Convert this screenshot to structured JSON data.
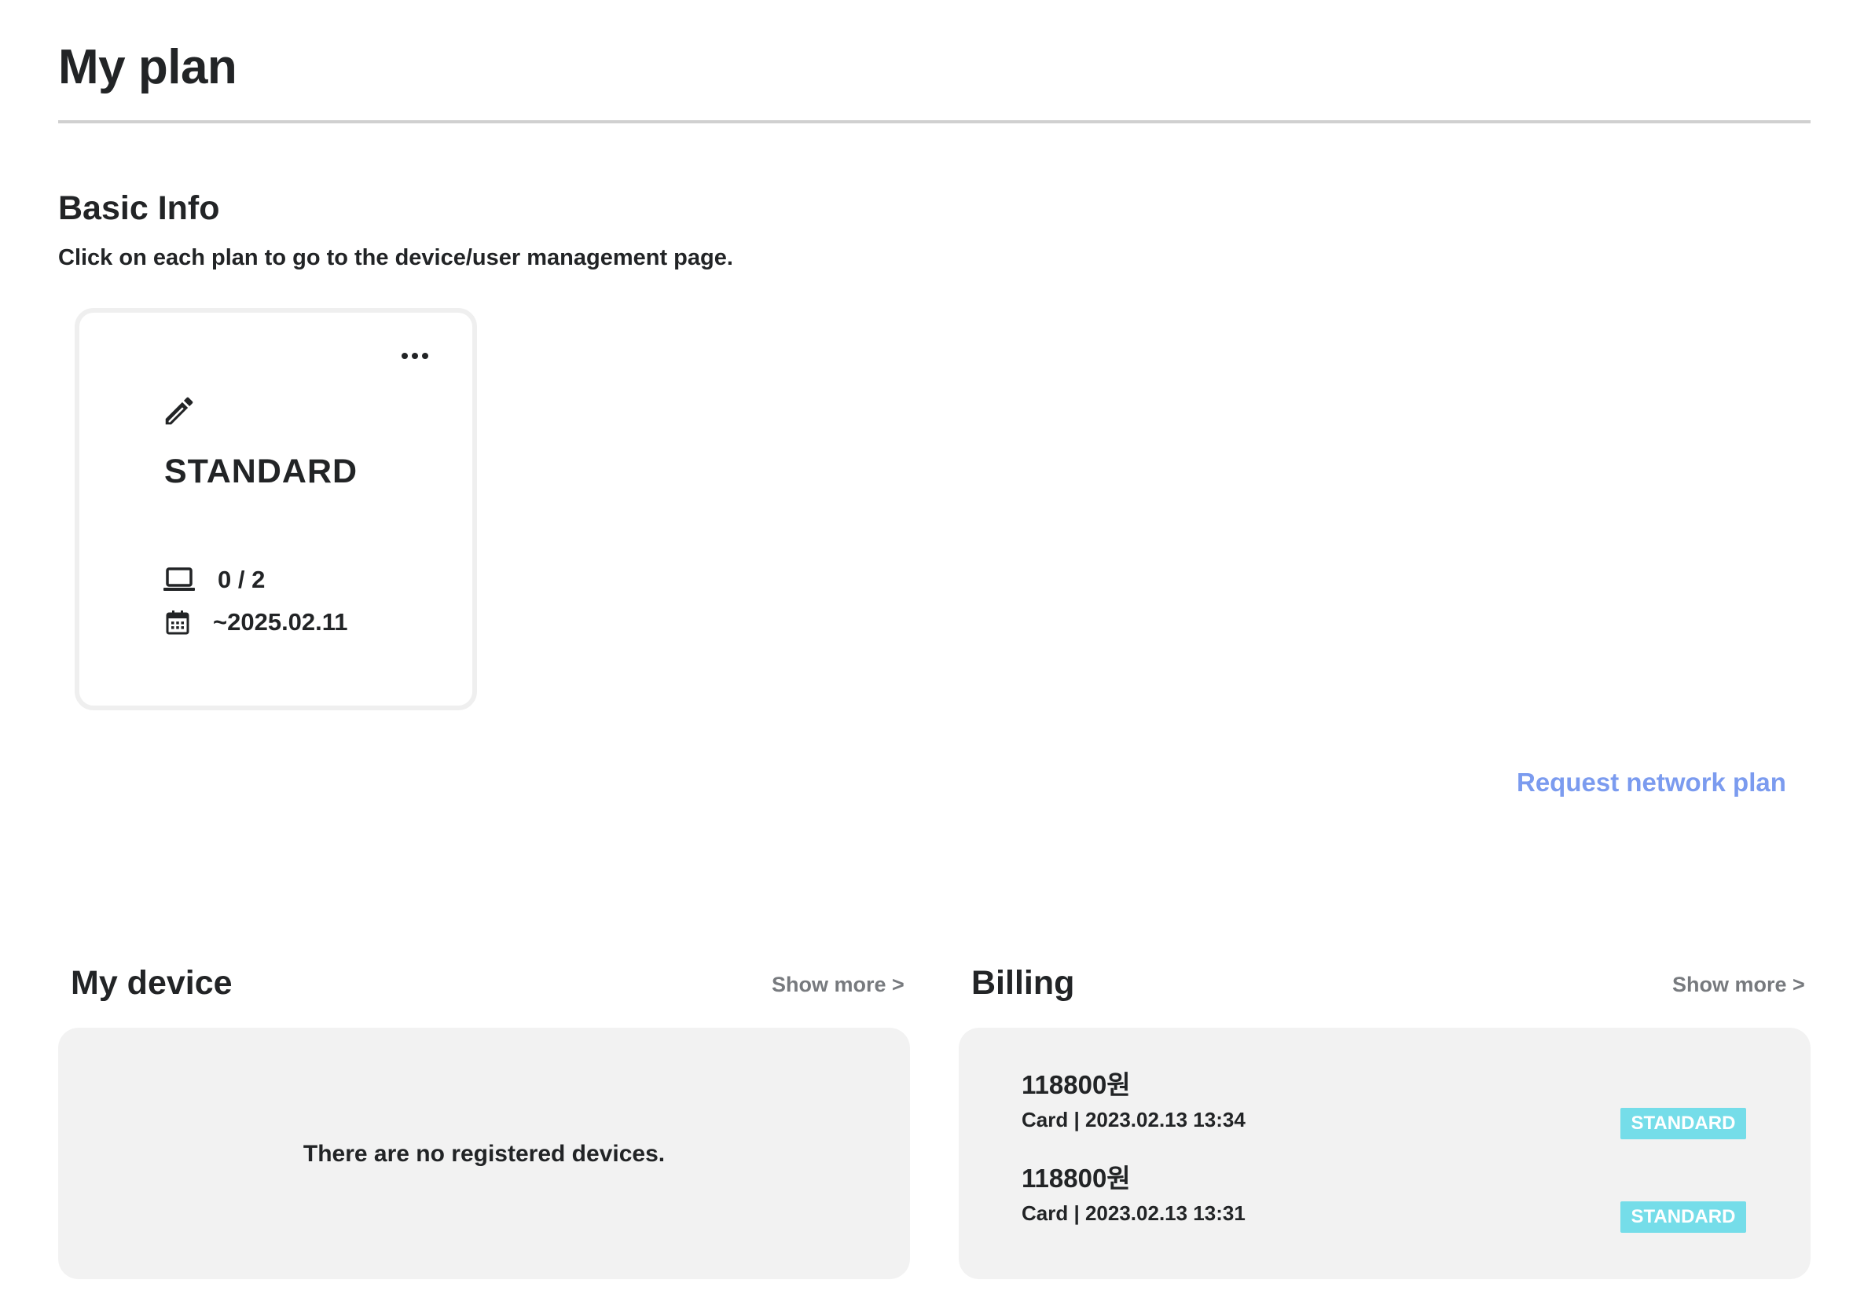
{
  "page": {
    "title": "My plan"
  },
  "basic_info": {
    "title": "Basic Info",
    "description": "Click on each plan to go to the device/user management page."
  },
  "plan_card": {
    "name": "STANDARD",
    "devices": "0 / 2",
    "expiry": "~2025.02.11",
    "menu_icon": "more-horizontal-icon",
    "edit_icon": "pencil-icon",
    "device_icon": "laptop-icon",
    "date_icon": "calendar-icon"
  },
  "request_link": "Request network plan",
  "my_device": {
    "title": "My device",
    "show_more": "Show more >",
    "empty_message": "There are no registered devices."
  },
  "billing": {
    "title": "Billing",
    "show_more": "Show more >",
    "items": [
      {
        "amount": "118800원",
        "meta": "Card | 2023.02.13 13:34",
        "badge": "STANDARD"
      },
      {
        "amount": "118800원",
        "meta": "Card | 2023.02.13 13:31",
        "badge": "STANDARD"
      }
    ]
  },
  "colors": {
    "text": "#222426",
    "divider": "#d0d0d0",
    "link": "#7b9bef",
    "muted": "#777a7e",
    "panel_bg": "#f2f2f2",
    "card_border": "#efefef",
    "badge_bg": "#75dde9"
  }
}
